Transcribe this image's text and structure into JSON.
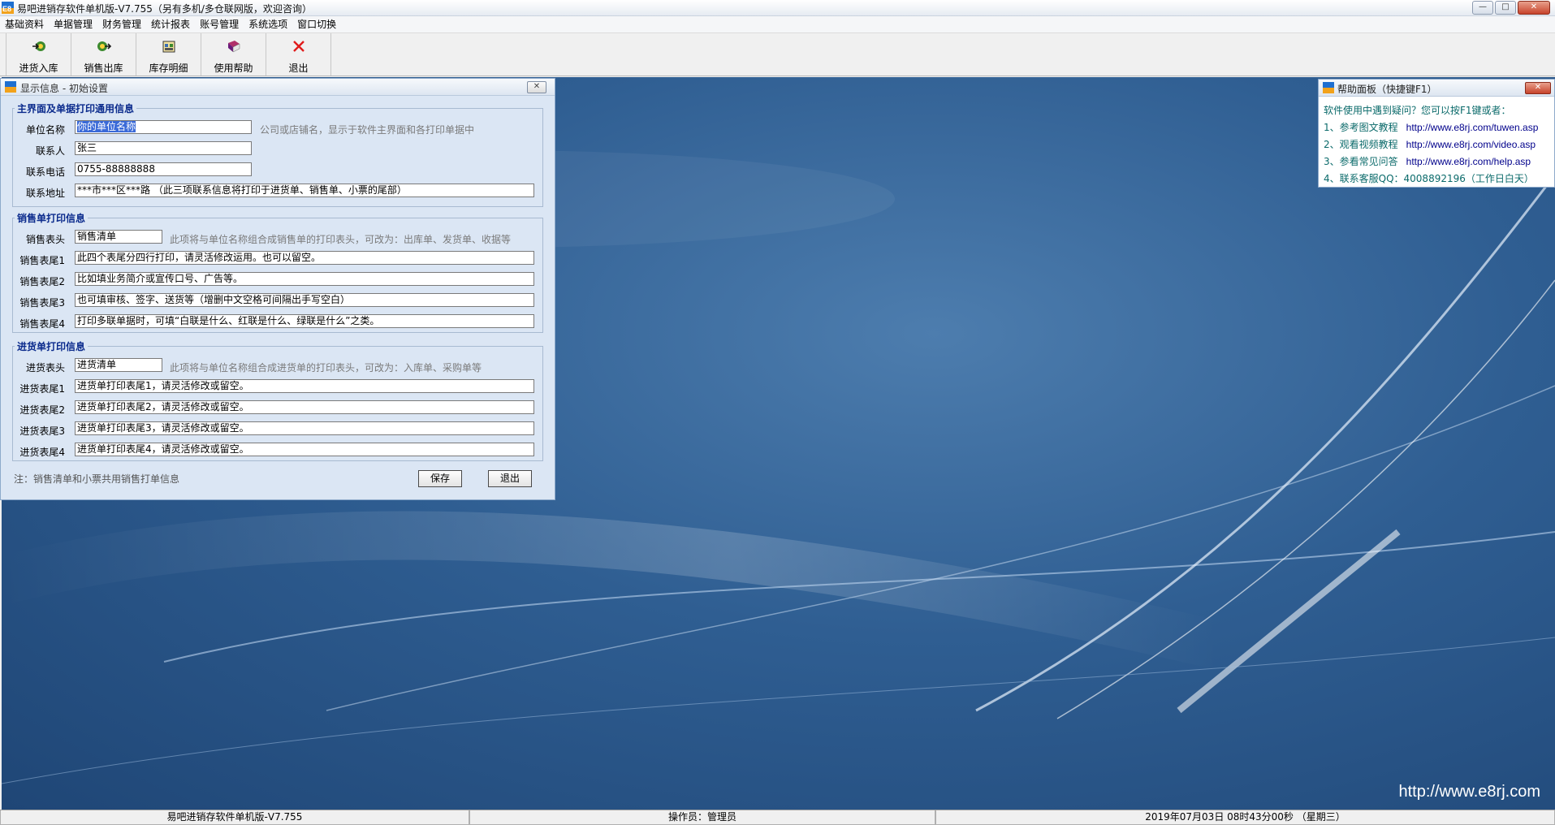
{
  "window": {
    "title": "易吧进销存软件单机版-V7.755（另有多机/多仓联网版，欢迎咨询）",
    "logo_text": "E8",
    "minimize": "—",
    "maximize": "□",
    "close": "✕"
  },
  "menu": [
    "基础资料",
    "单据管理",
    "财务管理",
    "统计报表",
    "账号管理",
    "系统选项",
    "窗口切换"
  ],
  "toolbar": {
    "stock_in": "进货入库",
    "sales_out": "销售出库",
    "inventory": "库存明细",
    "help": "使用帮助",
    "exit": "退出"
  },
  "settings_dialog": {
    "title": "显示信息 - 初始设置",
    "close": "✕",
    "group_main": {
      "title": "主界面及单据打印通用信息",
      "company_label": "单位名称",
      "company_value": "你的单位名称",
      "company_hint": "公司或店铺名，显示于软件主界面和各打印单据中",
      "contact_label": "联系人",
      "contact_value": "张三",
      "phone_label": "联系电话",
      "phone_value": "0755-88888888",
      "address_label": "联系地址",
      "address_value": "***市***区***路 （此三项联系信息将打印于进货单、销售单、小票的尾部）"
    },
    "group_sales": {
      "title": "销售单打印信息",
      "header_label": "销售表头",
      "header_value": "销售清单",
      "header_hint": "此项将与单位名称组合成销售单的打印表头，可改为：出库单、发货单、收据等",
      "footer1_label": "销售表尾1",
      "footer1_value": "此四个表尾分四行打印，请灵活修改运用。也可以留空。",
      "footer2_label": "销售表尾2",
      "footer2_value": "比如填业务简介或宣传口号、广告等。",
      "footer3_label": "销售表尾3",
      "footer3_value": "也可填审核、签字、送货等（增删中文空格可间隔出手写空白）",
      "footer4_label": "销售表尾4",
      "footer4_value": "打印多联单据时，可填“白联是什么、红联是什么、绿联是什么”之类。"
    },
    "group_purchase": {
      "title": "进货单打印信息",
      "header_label": "进货表头",
      "header_value": "进货清单",
      "header_hint": "此项将与单位名称组合成进货单的打印表头，可改为：入库单、采购单等",
      "footer1_label": "进货表尾1",
      "footer1_value": "进货单打印表尾1，请灵活修改或留空。",
      "footer2_label": "进货表尾2",
      "footer2_value": "进货单打印表尾2，请灵活修改或留空。",
      "footer3_label": "进货表尾3",
      "footer3_value": "进货单打印表尾3，请灵活修改或留空。",
      "footer4_label": "进货表尾4",
      "footer4_value": "进货单打印表尾4，请灵活修改或留空。"
    },
    "note": "注：销售清单和小票共用销售打单信息",
    "save": "保存",
    "exit": "退出"
  },
  "help_panel": {
    "title": "帮助面板（快捷键F1）",
    "close": "✕",
    "intro": "软件使用中遇到疑问？您可以按F1键或者：",
    "items": [
      {
        "label": "1、参考图文教程",
        "url": "http://www.e8rj.com/tuwen.asp"
      },
      {
        "label": "2、观看视频教程",
        "url": "http://www.e8rj.com/video.asp"
      },
      {
        "label": "3、参看常见问答",
        "url": "http://www.e8rj.com/help.asp"
      },
      {
        "label": "4、联系客服QQ：4008892196（工作日白天）",
        "url": ""
      }
    ]
  },
  "watermark": "http://www.e8rj.com",
  "status": {
    "version": "易吧进销存软件单机版-V7.755",
    "operator": "操作员：管理员",
    "datetime": "2019年07月03日 08时43分00秒 （星期三）"
  },
  "colors": {
    "legend": "#0a2a8c",
    "dialog_bg": "#dbe6f4",
    "desktop": "#2f5e92",
    "link": "#00008b",
    "help_text": "#0a6a6a",
    "selection": "#3a6ad8"
  }
}
